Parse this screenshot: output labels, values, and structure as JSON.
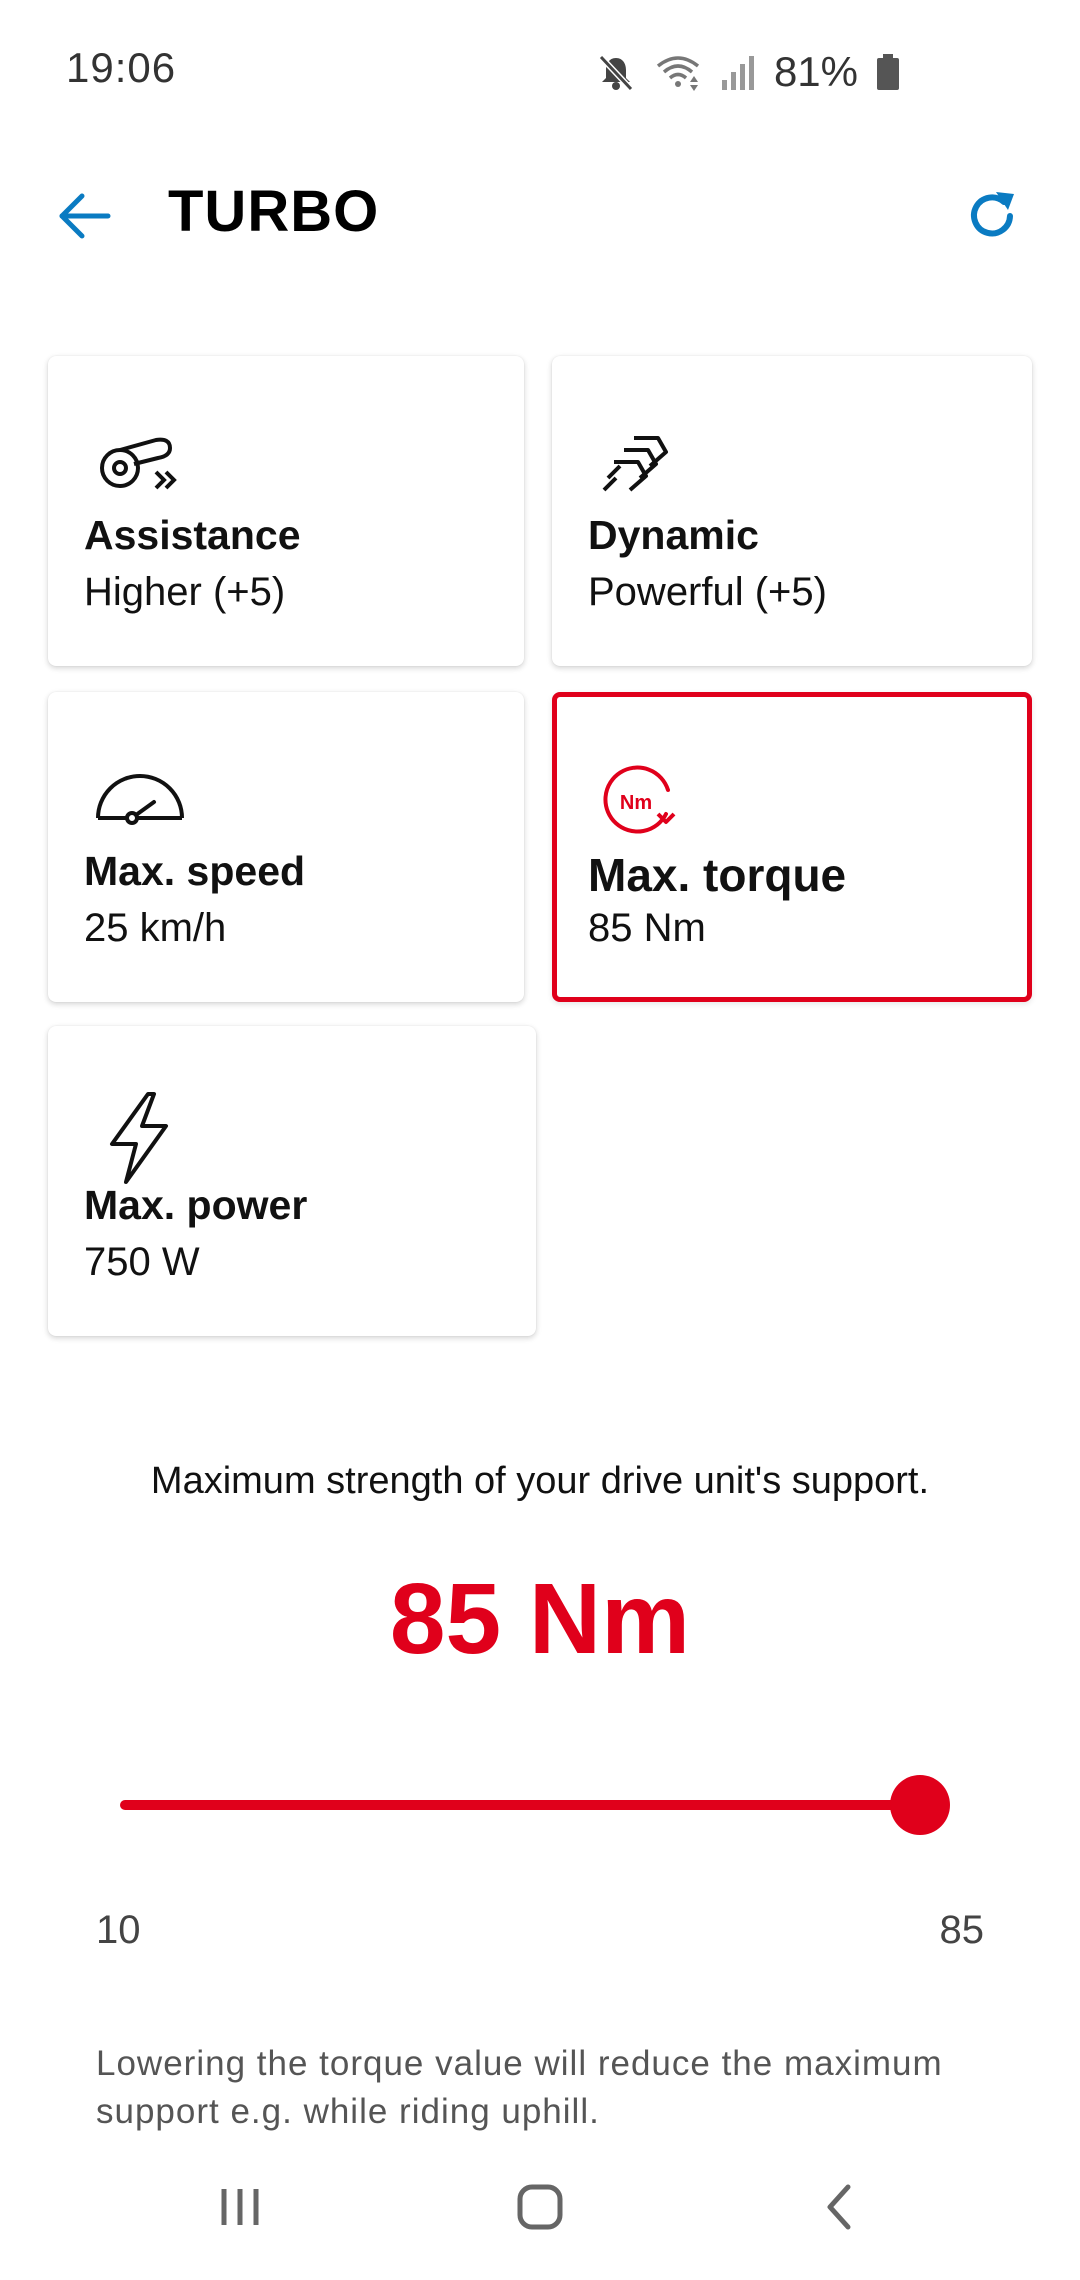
{
  "status_bar": {
    "time": "19:06",
    "battery": "81%",
    "icons": [
      "mute-icon",
      "wifi-icon",
      "signal-icon",
      "battery-icon"
    ]
  },
  "app_bar": {
    "title": "TURBO",
    "back_icon": "back-arrow-icon",
    "refresh_icon": "refresh-icon"
  },
  "cards": [
    {
      "title": "Assistance",
      "value": "Higher (+5)",
      "icon": "assistance-icon",
      "selected": false
    },
    {
      "title": "Dynamic",
      "value": "Powerful (+5)",
      "icon": "dynamic-icon",
      "selected": false
    },
    {
      "title": "Max. speed",
      "value": "25 km/h",
      "icon": "speedometer-icon",
      "selected": false
    },
    {
      "title": "Max. torque",
      "value": "85 Nm",
      "icon": "torque-icon",
      "selected": true
    },
    {
      "title": "Max. power",
      "value": "750 W",
      "icon": "lightning-icon",
      "selected": false
    }
  ],
  "torque_icon_label": "Nm",
  "detail": {
    "description": "Maximum strength of your drive unit's support.",
    "value_display": "85 Nm",
    "slider": {
      "min": 10,
      "max": 85,
      "value": 85,
      "min_label": "10",
      "max_label": "85"
    },
    "footnote": "Lowering the torque value will reduce the maximum support e.g. while riding uphill."
  },
  "colors": {
    "accent_red": "#e0001b",
    "accent_blue": "#0a7bc2"
  },
  "nav_bar": {
    "icons": [
      "recent-apps-icon",
      "home-icon",
      "back-icon"
    ]
  }
}
